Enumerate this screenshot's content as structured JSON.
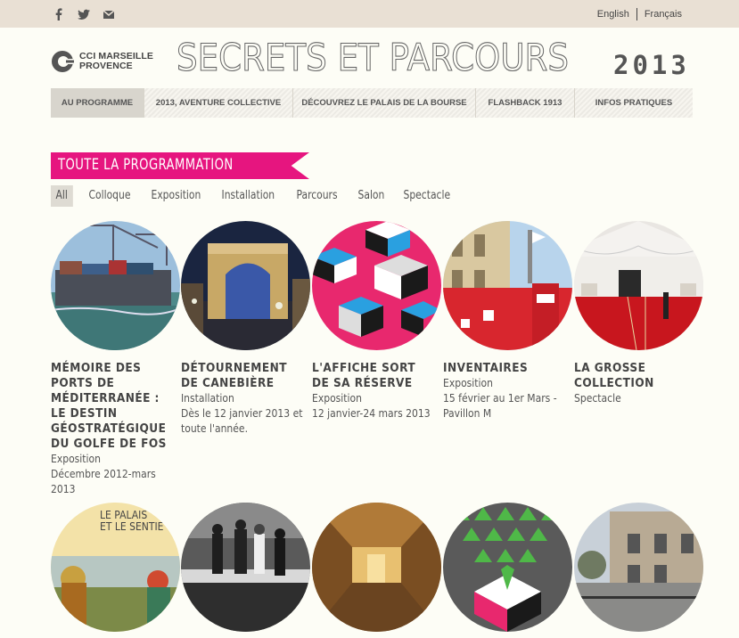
{
  "header": {
    "social": [
      "facebook-icon",
      "twitter-icon",
      "mail-icon"
    ],
    "languages": [
      "English",
      "Français"
    ],
    "logo_line1": "CCI MARSEILLE",
    "logo_line2": "PROVENCE",
    "site_title": "SECRETS ET PARCOURS",
    "year": "2013"
  },
  "nav": {
    "items": [
      "AU PROGRAMME",
      "2013, AVENTURE COLLECTIVE",
      "DÉCOUVREZ LE PALAIS DE LA BOURSE",
      "FLASHBACK 1913",
      "INFOS PRATIQUES"
    ],
    "active": "AU PROGRAMME"
  },
  "section_title": "TOUTE LA PROGRAMMATION",
  "filters": [
    "All",
    "Colloque",
    "Exposition",
    "Installation",
    "Parcours",
    "Salon",
    "Spectacle"
  ],
  "cards": [
    {
      "title": "MÉMOIRE DES PORTS DE MÉDITERRANÉE : LE DESTIN GÉOSTRATÉGIQUE DU GOLFE DE FOS",
      "type": "Exposition",
      "date": "Décembre 2012-mars 2013"
    },
    {
      "title": "DÉTOURNEMENT DE CANEBIÈRE",
      "type": "Installation",
      "date": "Dès le 12 janvier 2013 et toute l'année."
    },
    {
      "title": "L'AFFICHE SORT DE SA RÉSERVE",
      "type": "Exposition",
      "date": "12 janvier-24 mars 2013"
    },
    {
      "title": "INVENTAIRES",
      "type": "Exposition",
      "date": "15 février au 1er Mars - Pavillon M"
    },
    {
      "title": "LA GROSSE COLLECTION",
      "type": "Spectacle",
      "date": ""
    }
  ],
  "second_row": {
    "poster_line1": "LE PALAIS",
    "poster_line2": "ET LE SENTIE"
  },
  "colors": {
    "accent": "#e6157f",
    "background": "#fdfdf6",
    "topbar": "#e9e0d4"
  }
}
